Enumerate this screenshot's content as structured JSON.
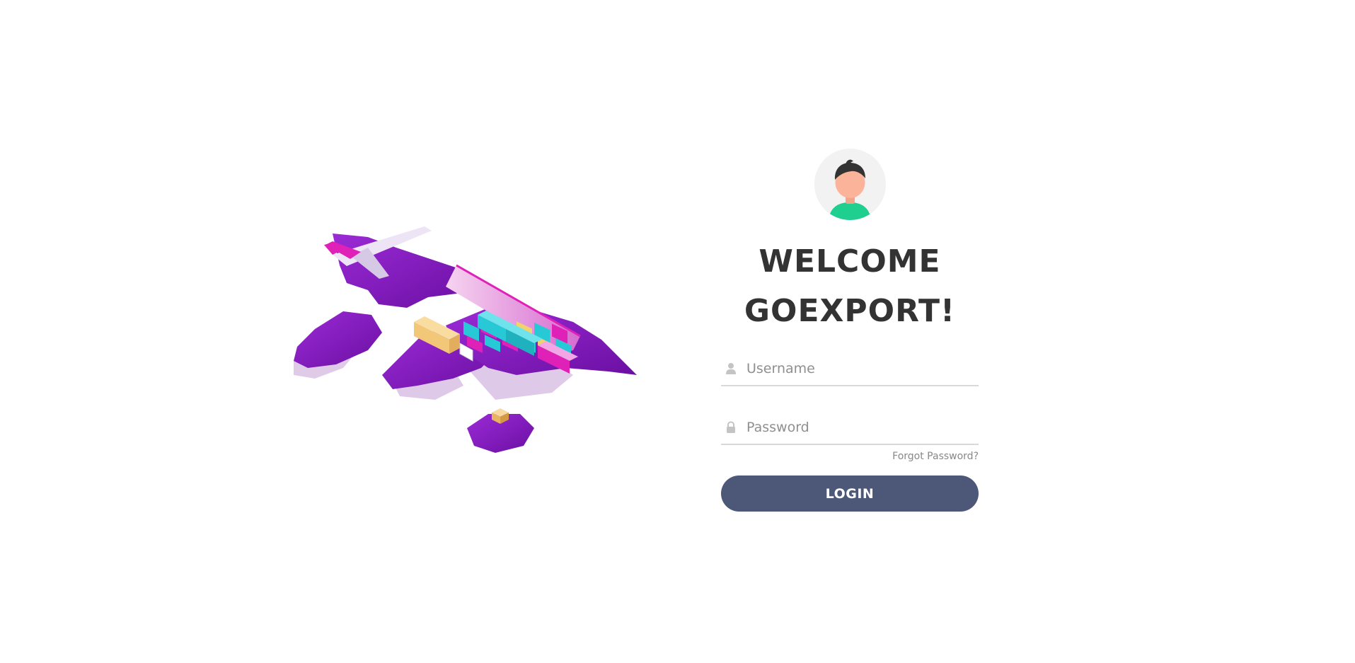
{
  "welcome": {
    "line1": "WELCOME",
    "line2": "GOEXPORT!"
  },
  "form": {
    "username_placeholder": "Username",
    "username_value": "",
    "password_placeholder": "Password",
    "password_value": "",
    "forgot_label": "Forgot Password?",
    "login_label": "LOGIN"
  },
  "icons": {
    "username": "user-icon",
    "password": "lock-icon",
    "avatar": "avatar-icon"
  },
  "colors": {
    "button": "#4d5878",
    "heading": "#333333",
    "accent_purple": "#8b1fc1",
    "accent_magenta": "#e021b8",
    "accent_cyan": "#27c9d6"
  }
}
